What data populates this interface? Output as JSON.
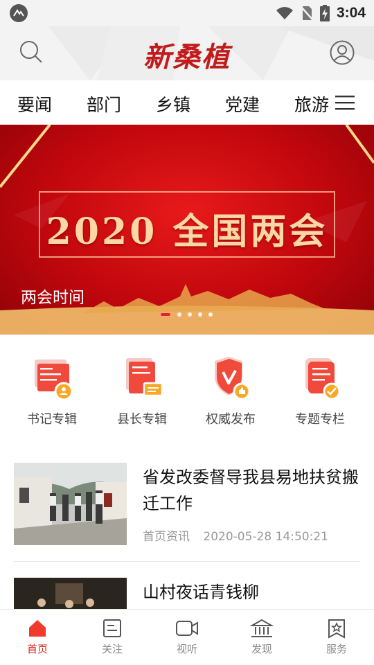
{
  "status_bar": {
    "time": "3:04"
  },
  "header": {
    "logo_text": "新桑植"
  },
  "tabs": [
    "要闻",
    "部门",
    "乡镇",
    "党建",
    "旅游"
  ],
  "banner": {
    "title": "2020 全国两会",
    "caption": "两会时间",
    "slide_count": 5,
    "active_slide": 1
  },
  "quick_links": [
    {
      "label": "书记专辑",
      "icon": "secretary-album-icon"
    },
    {
      "label": "县长专辑",
      "icon": "county-head-album-icon"
    },
    {
      "label": "权威发布",
      "icon": "authoritative-release-icon"
    },
    {
      "label": "专题专栏",
      "icon": "special-topic-icon"
    }
  ],
  "news": [
    {
      "title": "省发改委督导我县易地扶贫搬迁工作",
      "source": "首页资讯",
      "time": "2020-05-28 14:50:21"
    },
    {
      "title": "山村夜话青钱柳",
      "source": "",
      "time": ""
    }
  ],
  "bottom_nav": [
    {
      "label": "首页",
      "icon": "home-icon",
      "active": true
    },
    {
      "label": "关注",
      "icon": "follow-icon",
      "active": false
    },
    {
      "label": "视听",
      "icon": "video-icon",
      "active": false
    },
    {
      "label": "发现",
      "icon": "discover-icon",
      "active": false
    },
    {
      "label": "服务",
      "icon": "service-icon",
      "active": false
    }
  ],
  "colors": {
    "brand_red": "#d9261f",
    "banner_gold": "#fbd7a5"
  }
}
